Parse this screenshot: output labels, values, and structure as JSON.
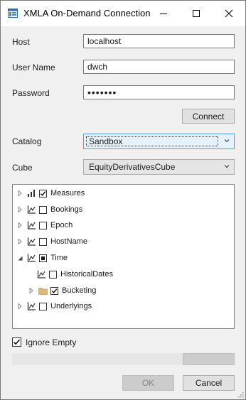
{
  "window": {
    "title": "XMLA On-Demand Connection"
  },
  "form": {
    "host_label": "Host",
    "host_value": "localhost",
    "user_label": "User Name",
    "user_value": "dwch",
    "password_label": "Password",
    "password_value": "•••••••",
    "connect_label": "Connect",
    "catalog_label": "Catalog",
    "catalog_value": "Sandbox",
    "cube_label": "Cube",
    "cube_value": "EquityDerivativesCube"
  },
  "tree": {
    "nodes": [
      {
        "label": "Measures",
        "checked": "checked",
        "expand": "collapsed",
        "icon": "bar-chart-icon"
      },
      {
        "label": "Bookings",
        "checked": "unchecked",
        "expand": "collapsed",
        "icon": "axis-icon"
      },
      {
        "label": "Epoch",
        "checked": "unchecked",
        "expand": "collapsed",
        "icon": "axis-icon"
      },
      {
        "label": "HostName",
        "checked": "unchecked",
        "expand": "collapsed",
        "icon": "axis-icon"
      },
      {
        "label": "Time",
        "checked": "indeterminate",
        "expand": "expanded",
        "icon": "axis-icon"
      },
      {
        "label": "HistoricalDates",
        "checked": "unchecked",
        "expand": "none",
        "icon": "axis-icon"
      },
      {
        "label": "Bucketing",
        "checked": "checked",
        "expand": "collapsed",
        "icon": "folder-icon"
      },
      {
        "label": "Underlyings",
        "checked": "unchecked",
        "expand": "collapsed",
        "icon": "axis-icon"
      }
    ]
  },
  "options": {
    "ignore_empty_label": "Ignore Empty",
    "ignore_empty_checked": true
  },
  "progress": {
    "value": 0
  },
  "footer": {
    "ok_label": "OK",
    "cancel_label": "Cancel"
  },
  "colors": {
    "accent": "#0078d7",
    "checkbox": "#333333",
    "folder": "#dcb67a",
    "progress": "#06b025"
  }
}
